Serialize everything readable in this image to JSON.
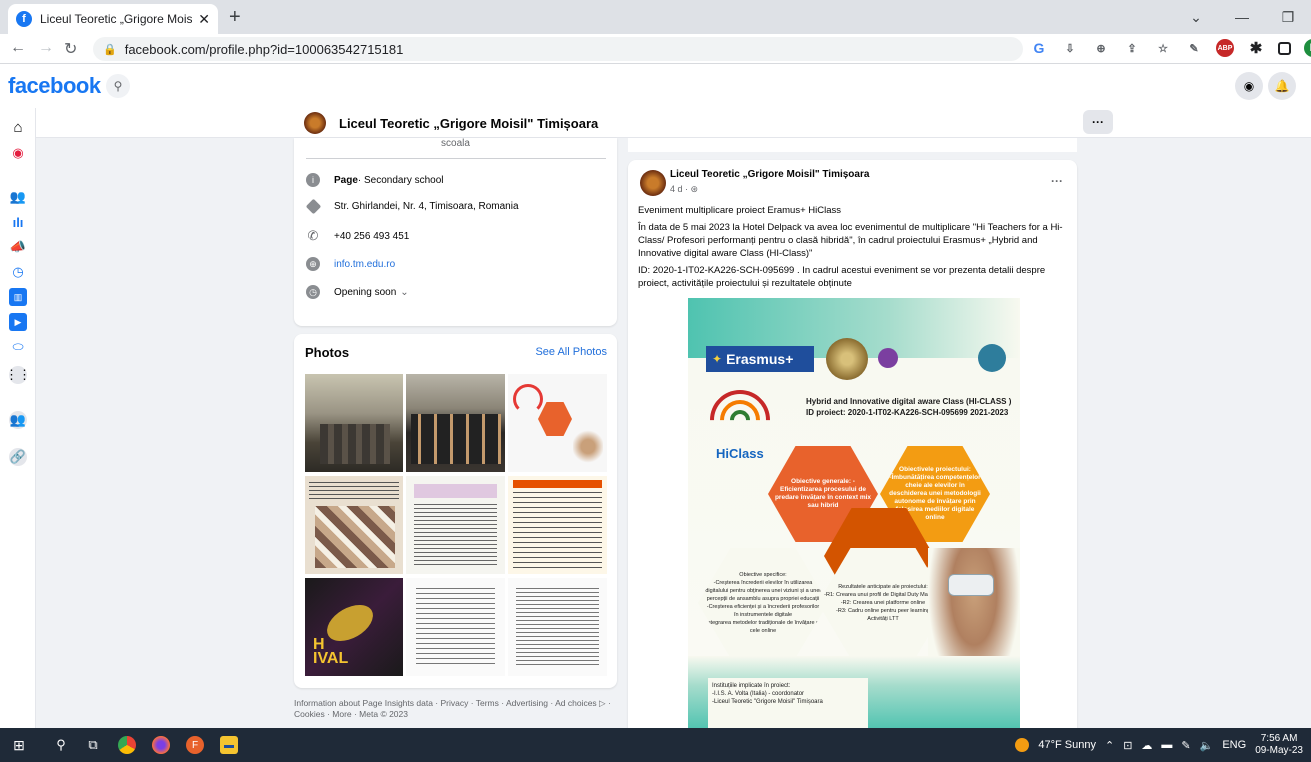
{
  "browser": {
    "tab_title": "Liceul Teoretic „Grigore Moisil\" Ti",
    "tab_close": "✕",
    "new_tab": "+",
    "url": "facebook.com/profile.php?id=100063542715181",
    "window_controls": {
      "minimize": "—",
      "restore": "❐",
      "dropdown": "⌄"
    },
    "extension_icons": [
      "google-g-icon",
      "bookmark-save-icon",
      "zoom-icon",
      "share-icon",
      "star-icon",
      "pen-icon",
      "adblock-icon",
      "puzzle-icon",
      "sidebar-icon",
      "profile-icon"
    ]
  },
  "facebook": {
    "logo": "facebook",
    "search_icon": "search-icon"
  },
  "page_header": {
    "name": "Liceul Teoretic „Grigore Moisil\" Timișoara",
    "more": "···"
  },
  "intro": {
    "cut_text": "scoala",
    "category_strong": "Page",
    "category_rest": " · Secondary school",
    "address": "Str. Ghirlandei, Nr. 4, Timisoara, Romania",
    "phone": "+40 256 493 451",
    "website": "info.tm.edu.ro",
    "hours": "Opening soon",
    "hours_caret": "⌄"
  },
  "photos": {
    "title": "Photos",
    "see_all": "See All Photos"
  },
  "footer": "Information about Page Insights data · Privacy · Terms · Advertising · Ad choices ▷ · Cookies · More · Meta © 2023",
  "post": {
    "author": "Liceul Teoretic „Grigore Moisil\" Timișoara",
    "time": "4 d · ⊛",
    "more": "···",
    "line1": "Eveniment multiplicare proiect Eramus+ HiClass",
    "line2": "În data de 5 mai 2023 la Hotel Delpack va avea loc evenimentul de multiplicare \"Hi Teachers for a Hi-Class/ Profesori performanți pentru o clasă hibridă\", în cadrul proiectului Erasmus+ „Hybrid and Innovative digital aware Class (HI-Class)\"",
    "line3": "ID: 2020-1-IT02-KA226-SCH-095699 . In cadrul acestui eveniment se vor prezenta detalii despre proiect, activitățile proiectului și rezultatele obținute"
  },
  "poster": {
    "erasmus": "Erasmus+",
    "title": "Hybrid and Innovative digital aware Class (HI-CLASS )",
    "project_id": "ID proiect: 2020-1-IT02-KA226-SCH-095699 2021-2023",
    "hiclass": "HiClass",
    "hex_left": "Obiective generale: -Eficientizarea procesului de predare învățare în context mix sau hibrid",
    "hex_right": "Obiectivele proiectului: -Îmbunătățirea competențelor cheie ale elevilor în deschiderea unei metodologii autonome de învățare prin folosirea mediilor digitale online",
    "bottom": "Instituțiile implicate în proiect:"
  },
  "taskbar": {
    "weather": "47°F  Sunny",
    "lang": "ENG",
    "time": "7:56 AM",
    "date": "09-May-23"
  }
}
